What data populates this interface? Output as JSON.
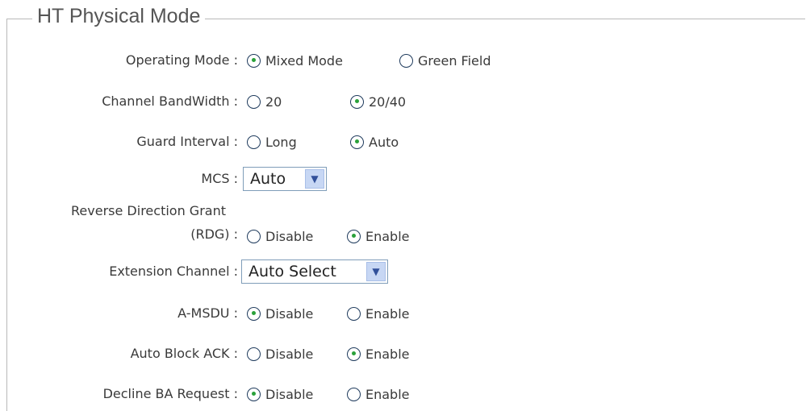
{
  "section": {
    "title": "HT Physical Mode"
  },
  "operating_mode": {
    "label": "Operating Mode :",
    "options": [
      "Mixed Mode",
      "Green Field"
    ],
    "selected": "Mixed Mode"
  },
  "channel_bandwidth": {
    "label": "Channel BandWidth :",
    "options": [
      "20",
      "20/40"
    ],
    "selected": "20/40"
  },
  "guard_interval": {
    "label": "Guard Interval :",
    "options": [
      "Long",
      "Auto"
    ],
    "selected": "Auto"
  },
  "mcs": {
    "label": "MCS :",
    "value": "Auto"
  },
  "rdg": {
    "label_line1": "Reverse Direction Grant",
    "label_line2": "(RDG) :",
    "options": [
      "Disable",
      "Enable"
    ],
    "selected": "Enable"
  },
  "extension_channel": {
    "label": "Extension Channel :",
    "value": "Auto Select"
  },
  "amsdu": {
    "label": "A-MSDU :",
    "options": [
      "Disable",
      "Enable"
    ],
    "selected": "Disable"
  },
  "auto_block_ack": {
    "label": "Auto Block ACK :",
    "options": [
      "Disable",
      "Enable"
    ],
    "selected": "Enable"
  },
  "decline_ba_request": {
    "label": "Decline BA Request :",
    "options": [
      "Disable",
      "Enable"
    ],
    "selected": "Disable"
  }
}
